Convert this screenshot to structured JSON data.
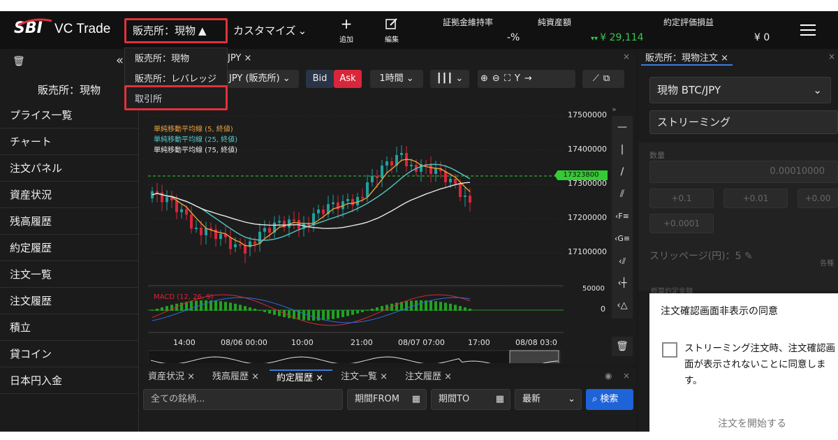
{
  "header": {
    "logo_sbi": "SBI",
    "logo_vc": "VC Trade",
    "market_btn": "販売所：現物",
    "customize": "カスタマイズ",
    "add": "追加",
    "edit": "編集",
    "margin_label": "証拠金維持率",
    "margin_value": "-%",
    "net_label": "純資産額",
    "net_value": "¥ 29,114",
    "pl_label": "約定評価損益",
    "pl_value": "¥ 0"
  },
  "dropdown": {
    "items": [
      "販売所：現物",
      "販売所：レバレッジ",
      "取引所"
    ]
  },
  "sidebar": {
    "title": "販売所：現物",
    "items": [
      "プライス一覧",
      "チャート",
      "注文パネル",
      "資産状況",
      "残高履歴",
      "約定履歴",
      "注文一覧",
      "注文履歴",
      "積立",
      "貸コイン",
      "日本円入金"
    ]
  },
  "chart_tab": "JPY",
  "toolbar": {
    "pair": "JPY (販売所)",
    "bid": "Bid",
    "ask": "Ask",
    "interval": "1時間"
  },
  "legend": [
    "単純移動平均線 (5, 終値)",
    "単純移動平均線 (25, 終値)",
    "単純移動平均線 (75, 終値)"
  ],
  "macd_label": "MACD (12, 26, 9)",
  "price_labels": [
    "17500000",
    "17400000",
    "17300000",
    "17200000",
    "17100000"
  ],
  "current_price": "17323800",
  "macd_axis": [
    "50000",
    "0"
  ],
  "time_labels": [
    "14:00",
    "08/06 00:00",
    "10:00",
    "21:00",
    "08/07 07:00",
    "17:00",
    "08/08 03:0"
  ],
  "bottom": {
    "tabs": [
      "資産状況",
      "残高履歴",
      "約定履歴",
      "注文一覧",
      "注文履歴"
    ],
    "search_placeholder": "全ての銘柄...",
    "from": "期間FROM",
    "to": "期間TO",
    "sort": "最新",
    "search_btn": "検索"
  },
  "right": {
    "tab": "販売所：現物注文",
    "pair": "現物 BTC/JPY",
    "mode": "ストリーミング",
    "qty_label": "数量",
    "qty_value": "0.00010000",
    "steps": [
      "+0.1",
      "+0.01",
      "+0.00",
      "+0.0001"
    ],
    "slippage": "スリッページ(円)：5",
    "slip_side": "各種",
    "approx_label": "概算約定金額",
    "consent_title": "注文確認画面非表示の同意",
    "consent_text": "ストリーミング注文時、注文確認画面が表示されないことに同意します。",
    "start": "注文を開始する"
  },
  "colors": {
    "up": "#1fa0a0",
    "down": "#d9263a",
    "ma5": "#e9a23b",
    "ma25": "#53c9c4",
    "ma75": "#e8e8e8",
    "price_tag": "#33cc33",
    "ask": "#d9263a",
    "accent": "#e0323c",
    "search": "#1e63d8"
  }
}
